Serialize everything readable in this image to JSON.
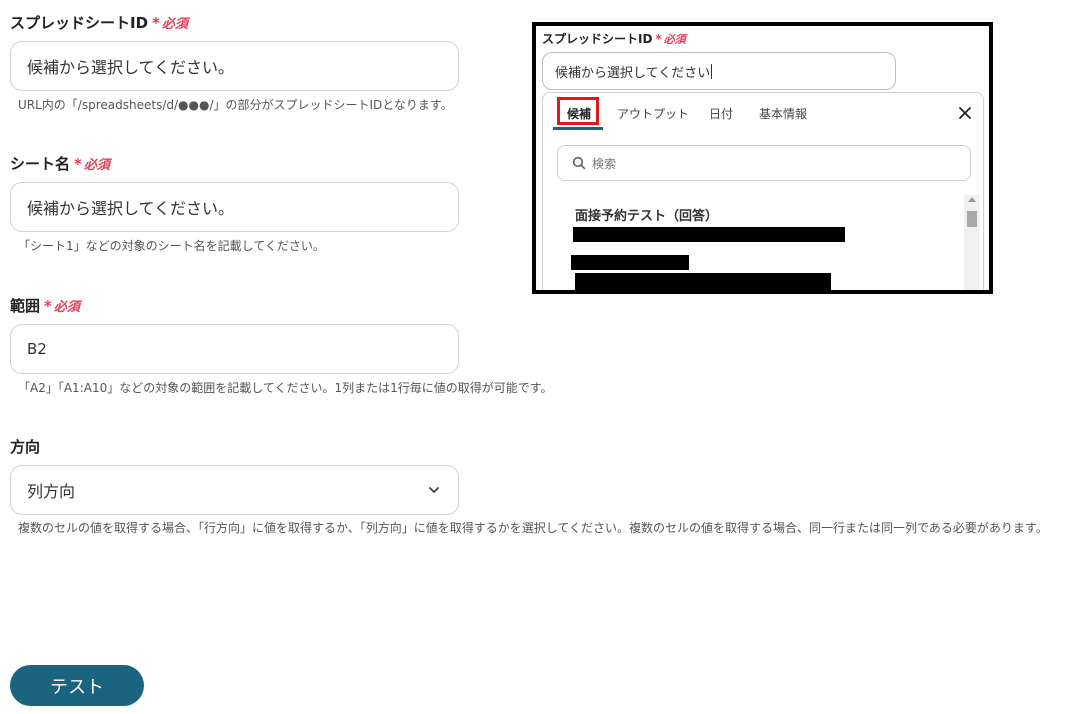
{
  "required": {
    "mark": "*",
    "text": "必須"
  },
  "fields": [
    {
      "label": "スプレッドシートID",
      "required": true,
      "value": "候補から選択してください。",
      "help": "URL内の「/spreadsheets/d/●●●/」の部分がスプレッドシートIDとなります。"
    },
    {
      "label": "シート名",
      "required": true,
      "value": "候補から選択してください。",
      "help": "「シート1」などの対象のシート名を記載してください。"
    },
    {
      "label": "範囲",
      "required": true,
      "value": "B2",
      "help": "「A2」「A1:A10」などの対象の範囲を記載してください。1列または1行毎に値の取得が可能です。"
    },
    {
      "label": "方向",
      "required": false,
      "value": "列方向",
      "help": "複数のセルの値を取得する場合、「行方向」に値を取得するか、「列方向」に値を取得するかを選択してください。複数のセルの値を取得する場合、同一行または同一列である必要があります。"
    }
  ],
  "test_button": "テスト",
  "inset": {
    "label": "スプレッドシートID",
    "input_value": "候補から選択してください",
    "tabs": [
      "候補",
      "アウトプット",
      "日付",
      "基本情報"
    ],
    "search_placeholder": "検索",
    "option_title": "面接予約テスト（回答）"
  },
  "colors": {
    "accent": "#1b6480",
    "required": "#e0405a",
    "highlight": "#e01a1a"
  }
}
